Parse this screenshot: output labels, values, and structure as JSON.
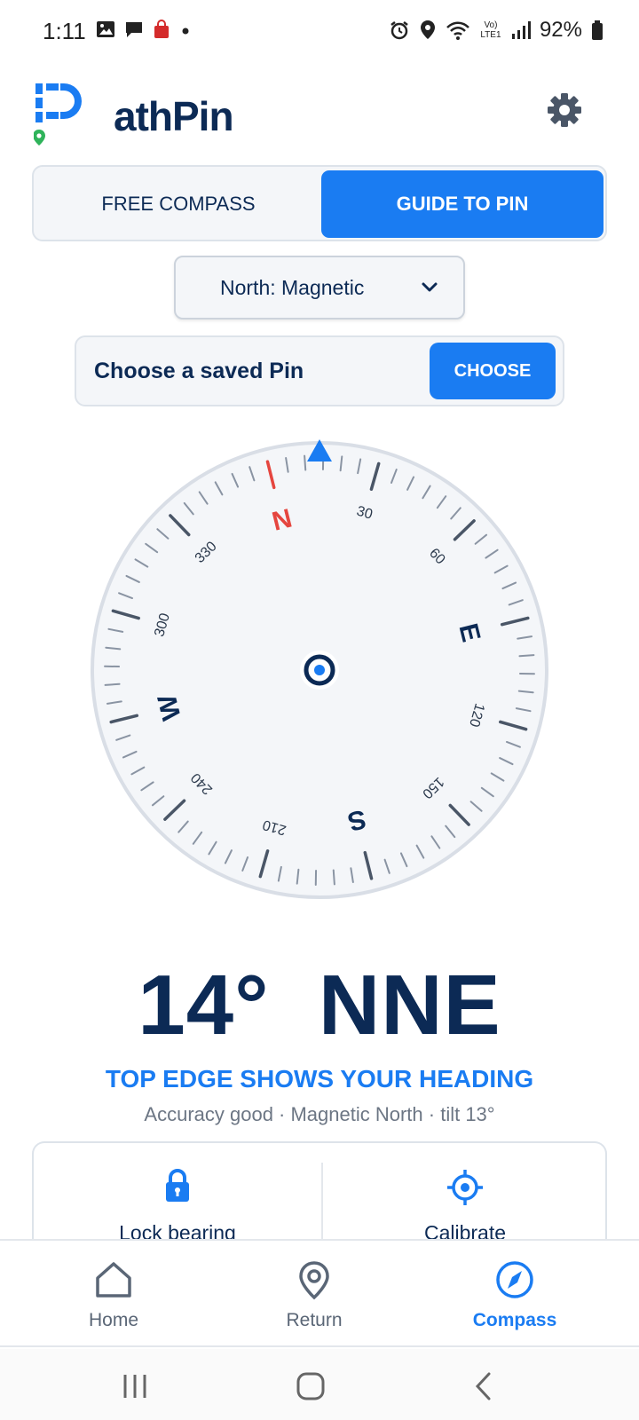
{
  "status_bar": {
    "time": "1:11",
    "battery": "92%",
    "network": "Vo) LTE1"
  },
  "app": {
    "name_rest": "athPin"
  },
  "mode_toggle": {
    "free_label": "FREE COMPASS",
    "guide_label": "GUIDE TO PIN",
    "selected": "GUIDE TO PIN"
  },
  "north_select": {
    "value": "North: Magnetic"
  },
  "saved_pin": {
    "label": "Choose a saved Pin",
    "button": "CHOOSE"
  },
  "compass": {
    "heading_deg": 14,
    "cardinals": {
      "N": "N",
      "E": "E",
      "S": "S",
      "W": "W"
    },
    "degree_labels": [
      "30",
      "60",
      "120",
      "150",
      "210",
      "240",
      "300",
      "330"
    ],
    "accent_color": "#1a7cf2",
    "north_color": "#e5463f"
  },
  "readout": {
    "heading": "14°  NNE",
    "hint": "TOP EDGE SHOWS YOUR HEADING",
    "status": "Accuracy good  ·  Magnetic North  ·  tilt 13°"
  },
  "actions": {
    "lock_label": "Lock bearing",
    "calibrate_label": "Calibrate"
  },
  "bottom_nav": {
    "items": [
      {
        "label": "Home",
        "icon": "home-icon"
      },
      {
        "label": "Return",
        "icon": "location-pin-icon"
      },
      {
        "label": "Compass",
        "icon": "compass-icon"
      }
    ],
    "active": "Compass"
  },
  "colors": {
    "primary": "#1a7cf2",
    "navy": "#0c2a55",
    "logo_green": "#2fb35a"
  }
}
